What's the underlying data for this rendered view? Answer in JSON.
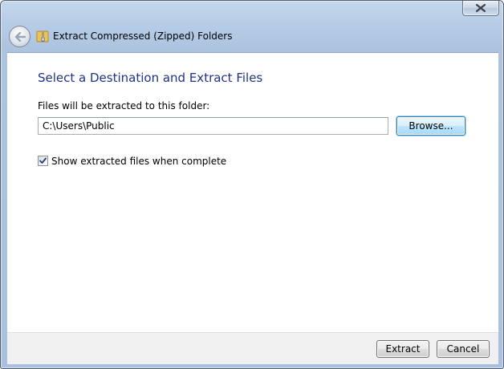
{
  "window": {
    "title": "Extract Compressed (Zipped) Folders",
    "close_icon": "close-icon",
    "back_icon": "back-arrow-icon",
    "folder_icon": "zip-folder-icon"
  },
  "main": {
    "heading": "Select a Destination and Extract Files",
    "field_label": "Files will be extracted to this folder:",
    "path_value": "C:\\Users\\Public",
    "browse_label": "Browse...",
    "show_files_label": "Show extracted files when complete",
    "show_files_checked": true
  },
  "footer": {
    "extract_label": "Extract",
    "cancel_label": "Cancel"
  },
  "colors": {
    "heading": "#1e3287",
    "chrome": "#b6cce6",
    "footer": "#f0f0f0"
  }
}
